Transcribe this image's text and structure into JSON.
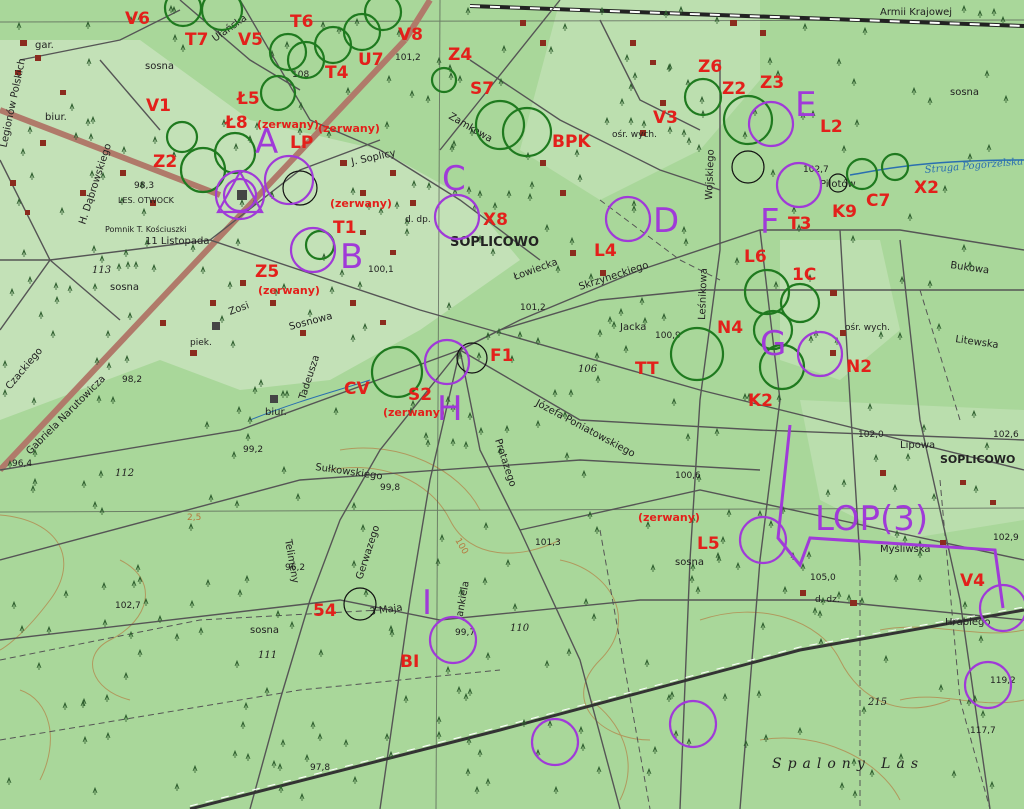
{
  "map": {
    "town_name": "SOPLICOWO",
    "town_name_east": "SOPLICOWO",
    "forest_name": "Spalony Las",
    "streets": [
      {
        "id": "armii",
        "text": "Armii Krajowej"
      },
      {
        "id": "ulanska",
        "text": "Ułańska"
      },
      {
        "id": "legionow",
        "text": "Legionów Polskich"
      },
      {
        "id": "dabrowskiego",
        "text": "H. Dąbrowskiego"
      },
      {
        "id": "listopada",
        "text": "11 Listopada"
      },
      {
        "id": "soplicy",
        "text": "J. Soplicy"
      },
      {
        "id": "zamkowa",
        "text": "Zamkowa"
      },
      {
        "id": "tadeusza",
        "text": "Tadeusza"
      },
      {
        "id": "lowiecka",
        "text": "Łowiecka"
      },
      {
        "id": "skrzyneckiego",
        "text": "Skrzyneckiego"
      },
      {
        "id": "jacka",
        "text": "Jacka"
      },
      {
        "id": "lesnikowa",
        "text": "Leśnikowa"
      },
      {
        "id": "wojskiego",
        "text": "Wojskiego"
      },
      {
        "id": "protazego",
        "text": "Protazego"
      },
      {
        "id": "poniatowskiego",
        "text": "Józefa Poniatowskiego"
      },
      {
        "id": "sulkowskiego",
        "text": "Sułkowskiego"
      },
      {
        "id": "narutowicza",
        "text": "Gabriela Narutowicza"
      },
      {
        "id": "czackiego",
        "text": "Czackiego"
      },
      {
        "id": "telimeny",
        "text": "Telimeny"
      },
      {
        "id": "gerwazego",
        "text": "Gerwazego"
      },
      {
        "id": "jankiela",
        "text": "Jankiela"
      },
      {
        "id": "maja",
        "text": "3 Maja"
      },
      {
        "id": "bukowa",
        "text": "Bukowa"
      },
      {
        "id": "litewska",
        "text": "Litewska"
      },
      {
        "id": "lipowa",
        "text": "Lipowa"
      },
      {
        "id": "mysliwska",
        "text": "Myśliwska"
      },
      {
        "id": "hrabiego",
        "text": "Hrabiego"
      },
      {
        "id": "pilotow",
        "text": "Pilotów"
      },
      {
        "id": "struga",
        "text": "Struga Pogorzelska"
      },
      {
        "id": "sosnowa",
        "text": "Sosnowa"
      },
      {
        "id": "tosa",
        "text": "Zosi"
      }
    ],
    "place_texts": [
      {
        "id": "sosna1",
        "text": "sosna"
      },
      {
        "id": "sosna2",
        "text": "sosna"
      },
      {
        "id": "sosna3",
        "text": "sosna"
      },
      {
        "id": "sosna4",
        "text": "sosna"
      },
      {
        "id": "sosna5",
        "text": "sosna"
      },
      {
        "id": "gar",
        "text": "gar."
      },
      {
        "id": "biur1",
        "text": "biur."
      },
      {
        "id": "biur2",
        "text": "biur."
      },
      {
        "id": "les",
        "text": "LES. OTWOCK"
      },
      {
        "id": "pomnik",
        "text": "Pomnik T. Kościuszki"
      },
      {
        "id": "osr1",
        "text": "ośr. wych."
      },
      {
        "id": "osr2",
        "text": "ośr. wych."
      },
      {
        "id": "piek",
        "text": "piek."
      },
      {
        "id": "ddp",
        "text": "d. dp."
      },
      {
        "id": "ddz",
        "text": "d. dz."
      }
    ],
    "elevations": [
      {
        "id": "e1",
        "text": "101,2"
      },
      {
        "id": "e2",
        "text": "98,3"
      },
      {
        "id": "e3",
        "text": "113"
      },
      {
        "id": "e4",
        "text": "100,1"
      },
      {
        "id": "e5",
        "text": "101,2"
      },
      {
        "id": "e6",
        "text": "98,2"
      },
      {
        "id": "e7",
        "text": "106"
      },
      {
        "id": "e8",
        "text": "100,9"
      },
      {
        "id": "e9",
        "text": "102,7"
      },
      {
        "id": "e10",
        "text": "99,2"
      },
      {
        "id": "e11",
        "text": "99,8"
      },
      {
        "id": "e12",
        "text": "112"
      },
      {
        "id": "e13",
        "text": "96,4"
      },
      {
        "id": "e14",
        "text": "100,6"
      },
      {
        "id": "e15",
        "text": "101,3"
      },
      {
        "id": "e16",
        "text": "96,2"
      },
      {
        "id": "e17",
        "text": "102,7"
      },
      {
        "id": "e18",
        "text": "111"
      },
      {
        "id": "e19",
        "text": "99,7"
      },
      {
        "id": "e20",
        "text": "110"
      },
      {
        "id": "e21",
        "text": "97,8"
      },
      {
        "id": "e22",
        "text": "102,0"
      },
      {
        "id": "e23",
        "text": "102,6"
      },
      {
        "id": "e24",
        "text": "102,9"
      },
      {
        "id": "e25",
        "text": "105,0"
      },
      {
        "id": "e26",
        "text": "119,2"
      },
      {
        "id": "e27",
        "text": "117,7"
      },
      {
        "id": "e28",
        "text": "215"
      },
      {
        "id": "e29",
        "text": "2,5"
      },
      {
        "id": "e30",
        "text": "100"
      },
      {
        "id": "e31",
        "text": "108"
      }
    ],
    "checkpoint_labels": [
      {
        "id": "V6",
        "text": "V6"
      },
      {
        "id": "T7",
        "text": "T7"
      },
      {
        "id": "V5",
        "text": "V5"
      },
      {
        "id": "T6",
        "text": "T6"
      },
      {
        "id": "V8",
        "text": "V8"
      },
      {
        "id": "U7",
        "text": "U7"
      },
      {
        "id": "T4",
        "text": "T4"
      },
      {
        "id": "Z4",
        "text": "Z4"
      },
      {
        "id": "S7",
        "text": "S7"
      },
      {
        "id": "Z6",
        "text": "Z6"
      },
      {
        "id": "Z2b",
        "text": "Z2"
      },
      {
        "id": "Z3",
        "text": "Z3"
      },
      {
        "id": "V3",
        "text": "V3"
      },
      {
        "id": "L2",
        "text": "L2"
      },
      {
        "id": "V1",
        "text": "V1"
      },
      {
        "id": "L5a",
        "text": "Ł5"
      },
      {
        "id": "L8",
        "text": "Ł8"
      },
      {
        "id": "LP",
        "text": "LP"
      },
      {
        "id": "BPK",
        "text": "BPK"
      },
      {
        "id": "Z2a",
        "text": "Z2"
      },
      {
        "id": "X8",
        "text": "X8"
      },
      {
        "id": "T1",
        "text": "T1"
      },
      {
        "id": "L4",
        "text": "L4"
      },
      {
        "id": "T3",
        "text": "T3"
      },
      {
        "id": "K9",
        "text": "K9"
      },
      {
        "id": "C7",
        "text": "C7"
      },
      {
        "id": "X2",
        "text": "X2"
      },
      {
        "id": "Z5",
        "text": "Z5"
      },
      {
        "id": "L6",
        "text": "L6"
      },
      {
        "id": "1C",
        "text": "1C"
      },
      {
        "id": "N4",
        "text": "N4"
      },
      {
        "id": "F1",
        "text": "F1"
      },
      {
        "id": "TT",
        "text": "TT"
      },
      {
        "id": "N2",
        "text": "N2"
      },
      {
        "id": "CV",
        "text": "CV"
      },
      {
        "id": "S2",
        "text": "S2"
      },
      {
        "id": "K2",
        "text": "K2"
      },
      {
        "id": "L5b",
        "text": "L5"
      },
      {
        "id": "V4",
        "text": "V4"
      },
      {
        "id": "54",
        "text": "54"
      },
      {
        "id": "BI",
        "text": "BI"
      }
    ],
    "zerwany_notes": [
      {
        "id": "z1",
        "text": "(zerwany)"
      },
      {
        "id": "z2",
        "text": "(zerwany)"
      },
      {
        "id": "z3",
        "text": "(zerwany)"
      },
      {
        "id": "z4",
        "text": "(zerwany)"
      },
      {
        "id": "z5",
        "text": "(zerwany)"
      },
      {
        "id": "z6",
        "text": "(zerwany)"
      }
    ],
    "zone_letters": [
      {
        "id": "A",
        "text": "A"
      },
      {
        "id": "B",
        "text": "B"
      },
      {
        "id": "C",
        "text": "C"
      },
      {
        "id": "D",
        "text": "D"
      },
      {
        "id": "E",
        "text": "E"
      },
      {
        "id": "F",
        "text": "F"
      },
      {
        "id": "G",
        "text": "G"
      },
      {
        "id": "H",
        "text": "H"
      },
      {
        "id": "I",
        "text": "I"
      },
      {
        "id": "LOP",
        "text": "LOP(3)"
      }
    ],
    "colors": {
      "base_green": "#a9d79a",
      "checkpoint_green": "#1f7a1f",
      "zone_purple": "#a03ad8",
      "label_red": "#e3201b",
      "road_brown": "#b07a6a"
    }
  }
}
